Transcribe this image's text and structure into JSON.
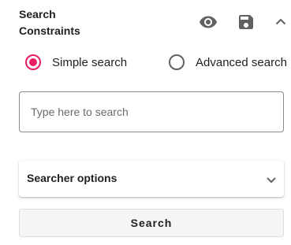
{
  "panel": {
    "title_line1": "Search",
    "title_line2": "Constraints",
    "icons": {
      "view": "eye-icon",
      "save": "floppy-disk-icon",
      "collapse": "chevron-up-icon"
    }
  },
  "search_mode": {
    "options": [
      {
        "label": "Simple search",
        "selected": true
      },
      {
        "label": "Advanced search",
        "selected": false
      }
    ],
    "accent_color": "#e91e63"
  },
  "search_field": {
    "value": "",
    "placeholder": "Type here to search"
  },
  "searcher_options": {
    "label": "Searcher options",
    "expanded": false,
    "icon": "chevron-down-icon"
  },
  "search_button": {
    "label": "Search"
  }
}
